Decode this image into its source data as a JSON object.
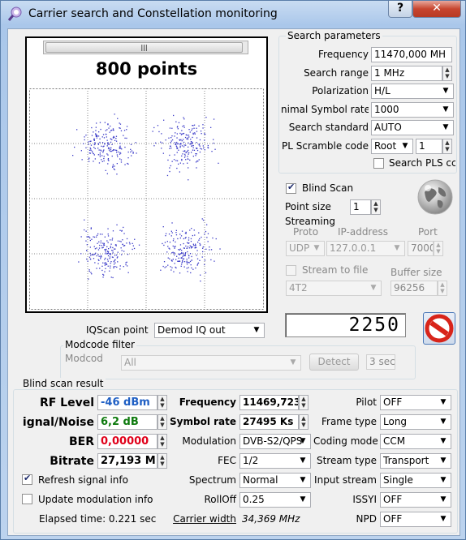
{
  "window": {
    "title": "Carrier search and Constellation monitoring",
    "help_label": "?",
    "close_label": "✕"
  },
  "constellation": {
    "points_label": "800 points",
    "scroll_thumb": "|||"
  },
  "search_params": {
    "group_label": "Search parameters",
    "frequency_label": "Frequency",
    "frequency_value": "11470,000 MH",
    "range_label": "Search range",
    "range_value": "1 MHz",
    "polarization_label": "Polarization",
    "polarization_value": "H/L",
    "symbol_rate_label": "nimal Symbol rate",
    "symbol_rate_value": "1000",
    "standard_label": "Search standard",
    "standard_value": "AUTO",
    "pl_label": "PL Scramble code",
    "pl_mode": "Root",
    "pl_value": "1",
    "search_pls_label": "Search PLS cc"
  },
  "blind_scan": {
    "label": "Blind Scan",
    "checked": true,
    "point_size_label": "Point size",
    "point_size_value": "1"
  },
  "streaming": {
    "group_label": "Streaming",
    "proto_label": "Proto",
    "proto_value": "UDP",
    "ip_label": "IP-address",
    "ip_value": "127.0.0.1",
    "port_label": "Port",
    "port_value": "7000",
    "stream_file_label": "Stream to file",
    "buffer_label": "Buffer size",
    "buffer_value": "96256",
    "format_value": "4T2"
  },
  "counter": {
    "value": "2250"
  },
  "iqscan": {
    "label": "IQScan point",
    "value": "Demod IQ out"
  },
  "modcode": {
    "group_label": "Modcode filter",
    "label": "Modcode",
    "value": "All",
    "detect_label": "Detect",
    "sec_value": "3 sec"
  },
  "result": {
    "group_label": "Blind scan result",
    "rf_label": "RF Level",
    "rf_value": "-46 dBm",
    "sn_label": "ignal/Noise",
    "sn_value": "6,2 dB",
    "ber_label": "BER",
    "ber_value": "0,00000",
    "bitrate_label": "Bitrate",
    "bitrate_value": "27,193 M",
    "freq_label": "Frequency",
    "freq_value": "11469,723",
    "sr_label": "Symbol rate",
    "sr_value": "27495 Ks",
    "mod_label": "Modulation",
    "mod_value": "DVB-S2/QPS",
    "fec_label": "FEC",
    "fec_value": "1/2",
    "spectrum_label": "Spectrum",
    "spectrum_value": "Normal",
    "rolloff_label": "RollOff",
    "rolloff_value": "0.25",
    "cw_label": "Carrier width",
    "cw_value": "34,369 MHz",
    "pilot_label": "Pilot",
    "pilot_value": "OFF",
    "frame_label": "Frame type",
    "frame_value": "Long",
    "coding_label": "Coding mode",
    "coding_value": "CCM",
    "stream_label": "Stream type",
    "stream_value": "Transport",
    "input_label": "Input stream",
    "input_value": "Single",
    "issyi_label": "ISSYI",
    "issyi_value": "OFF",
    "npd_label": "NPD",
    "npd_value": "OFF",
    "refresh_label": "Refresh signal info",
    "refresh_checked": true,
    "update_label": "Update modulation info",
    "update_checked": false,
    "elapsed_label": "Elapsed time: 0.221 sec"
  },
  "colors": {
    "rf_value": "#1f5fc4",
    "sn_value": "#0e7a0e",
    "ber_value": "#e0001a",
    "point": "#3b3bc8"
  }
}
